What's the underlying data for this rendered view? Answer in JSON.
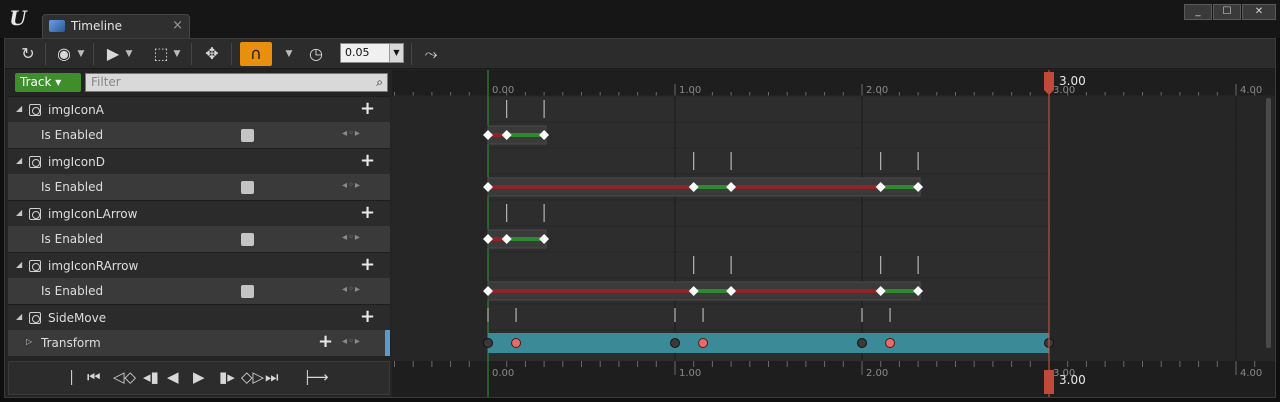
{
  "window": {
    "tab_title": "Timeline",
    "tab_close": "×",
    "min": "_",
    "max": "☐",
    "close": "✕"
  },
  "toolbar": {
    "snap_value": "0.05"
  },
  "tracklist": {
    "add_track_label": "Track",
    "filter_placeholder": "Filter",
    "rows": [
      {
        "type": "header",
        "name": "imgIconA"
      },
      {
        "type": "sub",
        "name": "Is Enabled"
      },
      {
        "type": "header",
        "name": "imgIconD"
      },
      {
        "type": "sub",
        "name": "Is Enabled"
      },
      {
        "type": "header",
        "name": "imgIconLArrow"
      },
      {
        "type": "sub",
        "name": "Is Enabled"
      },
      {
        "type": "header",
        "name": "imgIconRArrow"
      },
      {
        "type": "sub",
        "name": "Is Enabled"
      },
      {
        "type": "header",
        "name": "SideMove"
      },
      {
        "type": "sub",
        "name": "Transform"
      }
    ]
  },
  "timeline": {
    "ruler_labels": [
      "0.00",
      "1.00",
      "2.00",
      "3.00",
      "4.00"
    ],
    "playhead_label": "3.00",
    "playhead_time": 3.0,
    "view_start": -0.53,
    "view_end": 4.21,
    "tracks": [
      {
        "row": 1,
        "color_segments": [
          [
            0,
            0.1,
            "red"
          ],
          [
            0.1,
            0.3,
            "green"
          ]
        ],
        "keys": [
          0,
          0.1,
          0.3
        ],
        "end": 0.3
      },
      {
        "row": 3,
        "color_segments": [
          [
            0,
            1.1,
            "red"
          ],
          [
            1.1,
            1.3,
            "green"
          ],
          [
            1.3,
            2.1,
            "red"
          ],
          [
            2.1,
            2.3,
            "green"
          ]
        ],
        "keys": [
          0,
          1.1,
          1.3,
          2.1,
          2.3
        ],
        "end": 2.3
      },
      {
        "row": 5,
        "color_segments": [
          [
            0,
            0.1,
            "red"
          ],
          [
            0.1,
            0.3,
            "green"
          ]
        ],
        "keys": [
          0,
          0.1,
          0.3
        ],
        "end": 0.3
      },
      {
        "row": 7,
        "color_segments": [
          [
            0,
            1.1,
            "red"
          ],
          [
            1.1,
            1.3,
            "green"
          ],
          [
            1.3,
            2.1,
            "red"
          ],
          [
            2.1,
            2.3,
            "green"
          ]
        ],
        "keys": [
          0,
          1.1,
          1.3,
          2.1,
          2.3
        ],
        "end": 2.3
      },
      {
        "row": 9,
        "transform": true,
        "dark_keys": [
          0,
          1.0,
          2.0,
          3.0
        ],
        "red_keys": [
          0.15,
          1.15,
          2.15
        ],
        "end": 3.0
      }
    ],
    "colors": {
      "red": "#8f2424",
      "green": "#2f8a2f",
      "transform_bar": "#3b8a98",
      "playhead": "#c0493a"
    }
  }
}
